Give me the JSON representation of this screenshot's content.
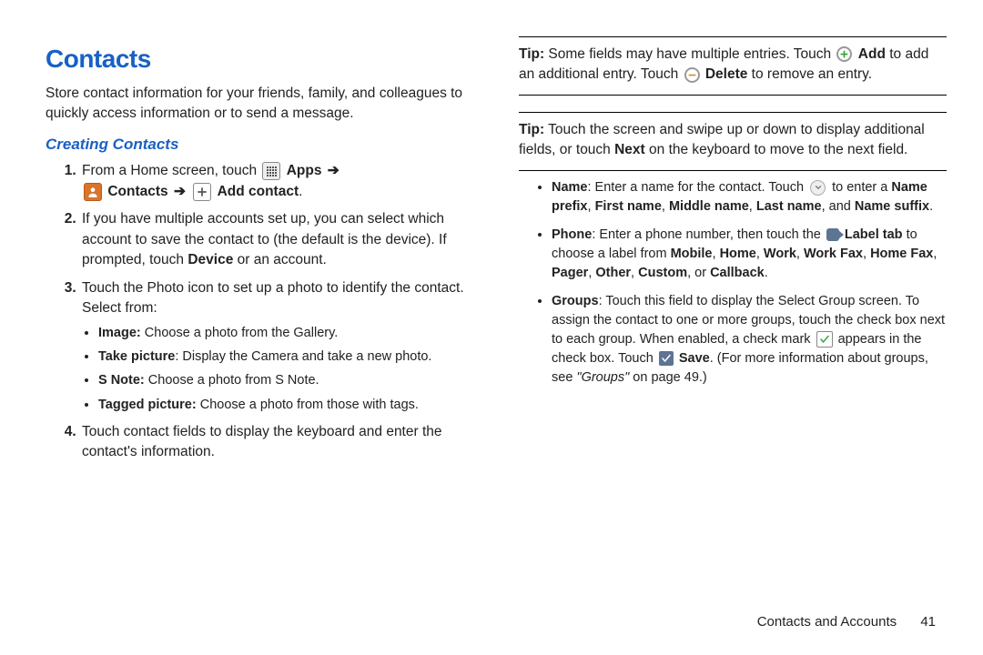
{
  "left": {
    "title": "Contacts",
    "intro": "Store contact information for your friends, family, and colleagues to quickly access information or to send a message.",
    "subhead": "Creating Contacts",
    "step1_a": "From a Home screen, touch ",
    "apps_label": " Apps",
    "arrow": " ➔ ",
    "contacts_label": " Contacts",
    "add_contact_label": " Add contact",
    "step2": "If you have multiple accounts set up, you can select which account to save the contact to (the default is the device). If prompted, touch ",
    "step2_device": "Device",
    "step2_end": " or an account.",
    "step3": "Touch the Photo icon to set up a photo to identify the contact. Select from:",
    "sub": {
      "image_b": "Image:",
      "image_t": " Choose a photo from the Gallery.",
      "take_b": "Take picture",
      "take_t": ": Display the Camera and take a new photo.",
      "snote_b": "S Note:",
      "snote_t": " Choose a photo from S Note.",
      "tag_b": "Tagged picture:",
      "tag_t": " Choose a photo from those with tags."
    },
    "step4": "Touch contact fields to display the keyboard and enter the contact's information."
  },
  "right": {
    "tip1_a": "Tip:",
    "tip1_b": " Some fields may have multiple entries. Touch ",
    "tip1_add": " Add",
    "tip1_c": " to add an additional entry. Touch ",
    "tip1_del": " Delete",
    "tip1_d": " to remove an entry.",
    "tip2_a": "Tip:",
    "tip2_b": " Touch the screen and swipe up or down to display additional fields, or touch ",
    "tip2_next": "Next",
    "tip2_c": " on the keyboard to move to the next field.",
    "name_a": "Name",
    "name_b": ": Enter a name for the contact. Touch ",
    "name_c": " to enter a ",
    "name_d": "Name prefix",
    "name_e": ", ",
    "name_f": "First name",
    "name_g": ", ",
    "name_h": "Middle name",
    "name_i": ", ",
    "name_j": "Last name",
    "name_k": ", and ",
    "name_l": "Name suffix",
    "name_m": ".",
    "phone_a": "Phone",
    "phone_b": ": Enter a phone number, then touch the ",
    "phone_label": " Label tab",
    "phone_c": " to choose a label from ",
    "phone_d": "Mobile",
    "phone_e": ", ",
    "phone_f": "Home",
    "phone_g": ", ",
    "phone_h": "Work",
    "phone_i": ", ",
    "phone_j": "Work Fax",
    "phone_k": ", ",
    "phone_l": "Home Fax",
    "phone_m": ", ",
    "phone_n": "Pager",
    "phone_o": ", ",
    "phone_p": "Other",
    "phone_q": ", ",
    "phone_r": "Custom",
    "phone_s": ", or ",
    "phone_t": "Callback",
    "phone_u": ".",
    "groups_a": "Groups",
    "groups_b": ": Touch this field to display the Select Group screen. To assign the contact to one or more groups, touch the check box next to each group. When enabled, a check mark ",
    "groups_c": " appears in the check box. Touch ",
    "groups_save": " Save",
    "groups_d": ". (For more information about groups, see ",
    "groups_ref": "\"Groups\"",
    "groups_e": " on page 49.)"
  },
  "footer": {
    "chapter": "Contacts and Accounts",
    "page": "41"
  }
}
